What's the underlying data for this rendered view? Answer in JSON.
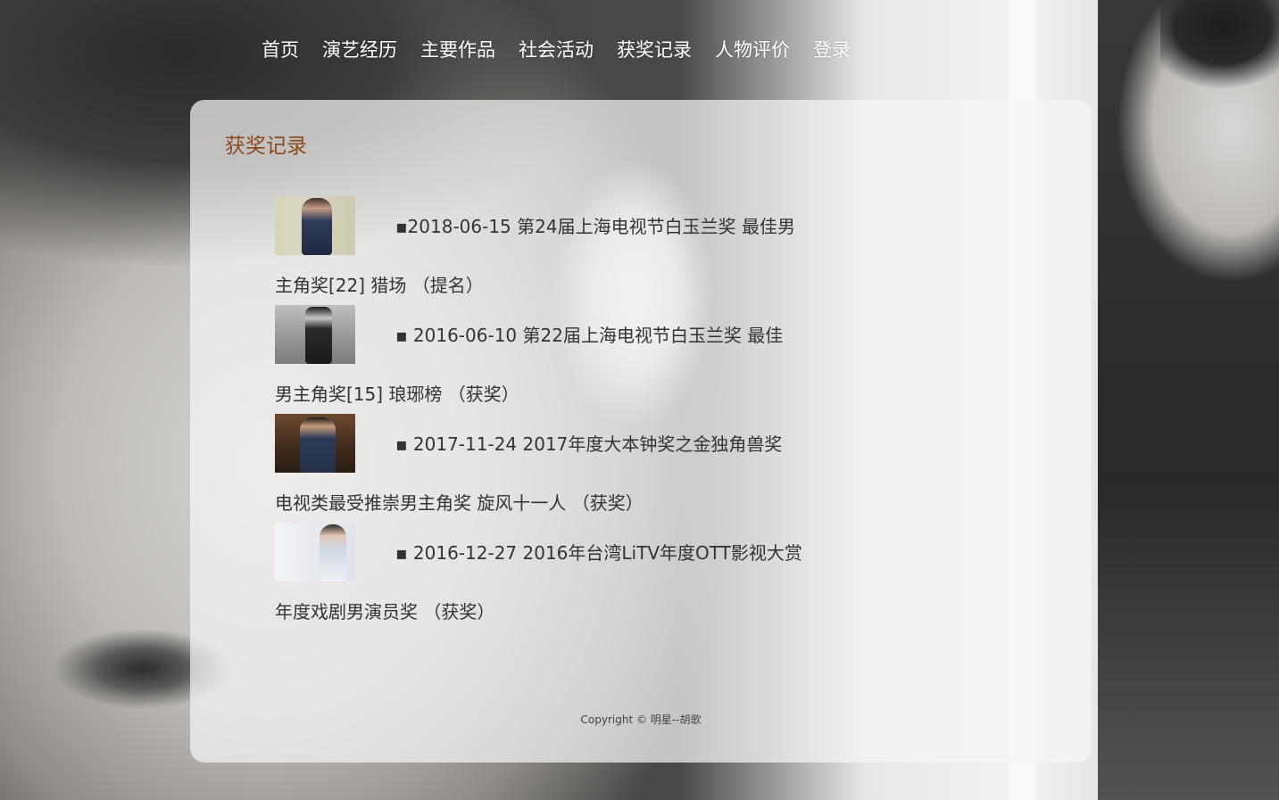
{
  "nav": {
    "items": [
      {
        "label": "首页"
      },
      {
        "label": "演艺经历"
      },
      {
        "label": "主要作品"
      },
      {
        "label": "社会活动"
      },
      {
        "label": "获奖记录"
      },
      {
        "label": "人物评价"
      },
      {
        "label": "登录"
      }
    ]
  },
  "main": {
    "title": "获奖记录",
    "awards": [
      {
        "line1": "▪2018-06-15 第24届上海电视节白玉兰奖 最佳男",
        "line2": "主角奖[22] 猎场 （提名）"
      },
      {
        "line1": "▪ 2016-06-10 第22届上海电视节白玉兰奖 最佳",
        "line2": "男主角奖[15] 琅琊榜 （获奖）"
      },
      {
        "line1": "▪ 2017-11-24 2017年度大本钟奖之金独角兽奖",
        "line2": "电视类最受推崇男主角奖 旋风十一人 （获奖）"
      },
      {
        "line1": "▪ 2016-12-27 2016年台湾LiTV年度OTT影视大赏",
        "line2": "年度戏剧男演员奖 （获奖）"
      }
    ]
  },
  "footer": {
    "text": "Copyright © 明星--胡歌"
  }
}
